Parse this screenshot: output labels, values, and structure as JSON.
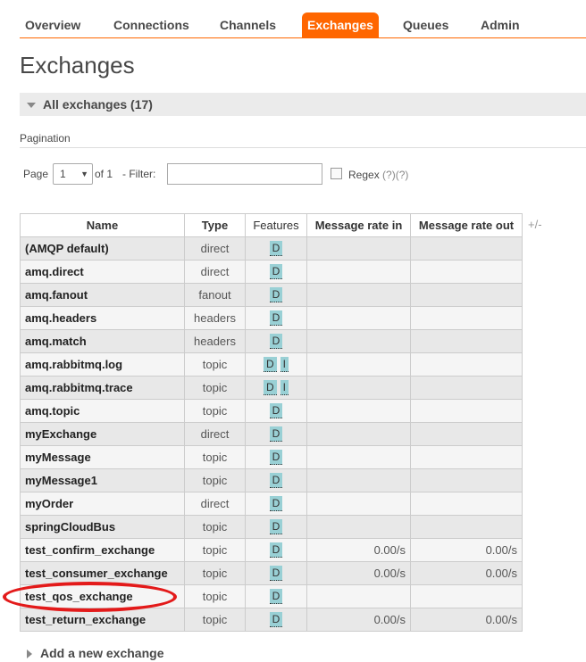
{
  "nav": {
    "tabs": [
      {
        "label": "Overview",
        "active": false
      },
      {
        "label": "Connections",
        "active": false
      },
      {
        "label": "Channels",
        "active": false
      },
      {
        "label": "Exchanges",
        "active": true
      },
      {
        "label": "Queues",
        "active": false
      },
      {
        "label": "Admin",
        "active": false
      }
    ]
  },
  "page_title": "Exchanges",
  "section": {
    "title": "All exchanges (17)"
  },
  "pagination": {
    "label": "Pagination",
    "page_label": "Page",
    "page_value": "1",
    "of_label": "of 1",
    "filter_label": "- Filter:",
    "filter_value": "",
    "regex_label": "Regex",
    "help_1": "(?)",
    "help_2": "(?)"
  },
  "table": {
    "headers": [
      "Name",
      "Type",
      "Features",
      "Message rate in",
      "Message rate out"
    ],
    "plus_minus": "+/-",
    "rows": [
      {
        "name": "(AMQP default)",
        "type": "direct",
        "features": [
          "D"
        ],
        "rate_in": "",
        "rate_out": ""
      },
      {
        "name": "amq.direct",
        "type": "direct",
        "features": [
          "D"
        ],
        "rate_in": "",
        "rate_out": ""
      },
      {
        "name": "amq.fanout",
        "type": "fanout",
        "features": [
          "D"
        ],
        "rate_in": "",
        "rate_out": ""
      },
      {
        "name": "amq.headers",
        "type": "headers",
        "features": [
          "D"
        ],
        "rate_in": "",
        "rate_out": ""
      },
      {
        "name": "amq.match",
        "type": "headers",
        "features": [
          "D"
        ],
        "rate_in": "",
        "rate_out": ""
      },
      {
        "name": "amq.rabbitmq.log",
        "type": "topic",
        "features": [
          "D",
          "I"
        ],
        "rate_in": "",
        "rate_out": ""
      },
      {
        "name": "amq.rabbitmq.trace",
        "type": "topic",
        "features": [
          "D",
          "I"
        ],
        "rate_in": "",
        "rate_out": ""
      },
      {
        "name": "amq.topic",
        "type": "topic",
        "features": [
          "D"
        ],
        "rate_in": "",
        "rate_out": ""
      },
      {
        "name": "myExchange",
        "type": "direct",
        "features": [
          "D"
        ],
        "rate_in": "",
        "rate_out": ""
      },
      {
        "name": "myMessage",
        "type": "topic",
        "features": [
          "D"
        ],
        "rate_in": "",
        "rate_out": ""
      },
      {
        "name": "myMessage1",
        "type": "topic",
        "features": [
          "D"
        ],
        "rate_in": "",
        "rate_out": ""
      },
      {
        "name": "myOrder",
        "type": "direct",
        "features": [
          "D"
        ],
        "rate_in": "",
        "rate_out": ""
      },
      {
        "name": "springCloudBus",
        "type": "topic",
        "features": [
          "D"
        ],
        "rate_in": "",
        "rate_out": ""
      },
      {
        "name": "test_confirm_exchange",
        "type": "topic",
        "features": [
          "D"
        ],
        "rate_in": "0.00/s",
        "rate_out": "0.00/s"
      },
      {
        "name": "test_consumer_exchange",
        "type": "topic",
        "features": [
          "D"
        ],
        "rate_in": "0.00/s",
        "rate_out": "0.00/s"
      },
      {
        "name": "test_qos_exchange",
        "type": "topic",
        "features": [
          "D"
        ],
        "rate_in": "",
        "rate_out": ""
      },
      {
        "name": "test_return_exchange",
        "type": "topic",
        "features": [
          "D"
        ],
        "rate_in": "0.00/s",
        "rate_out": "0.00/s"
      }
    ]
  },
  "add_section": {
    "title": "Add a new exchange"
  },
  "colors": {
    "accent": "#ff6600",
    "highlight": "#e31a1a",
    "feature_badge": "#99d0d5"
  }
}
